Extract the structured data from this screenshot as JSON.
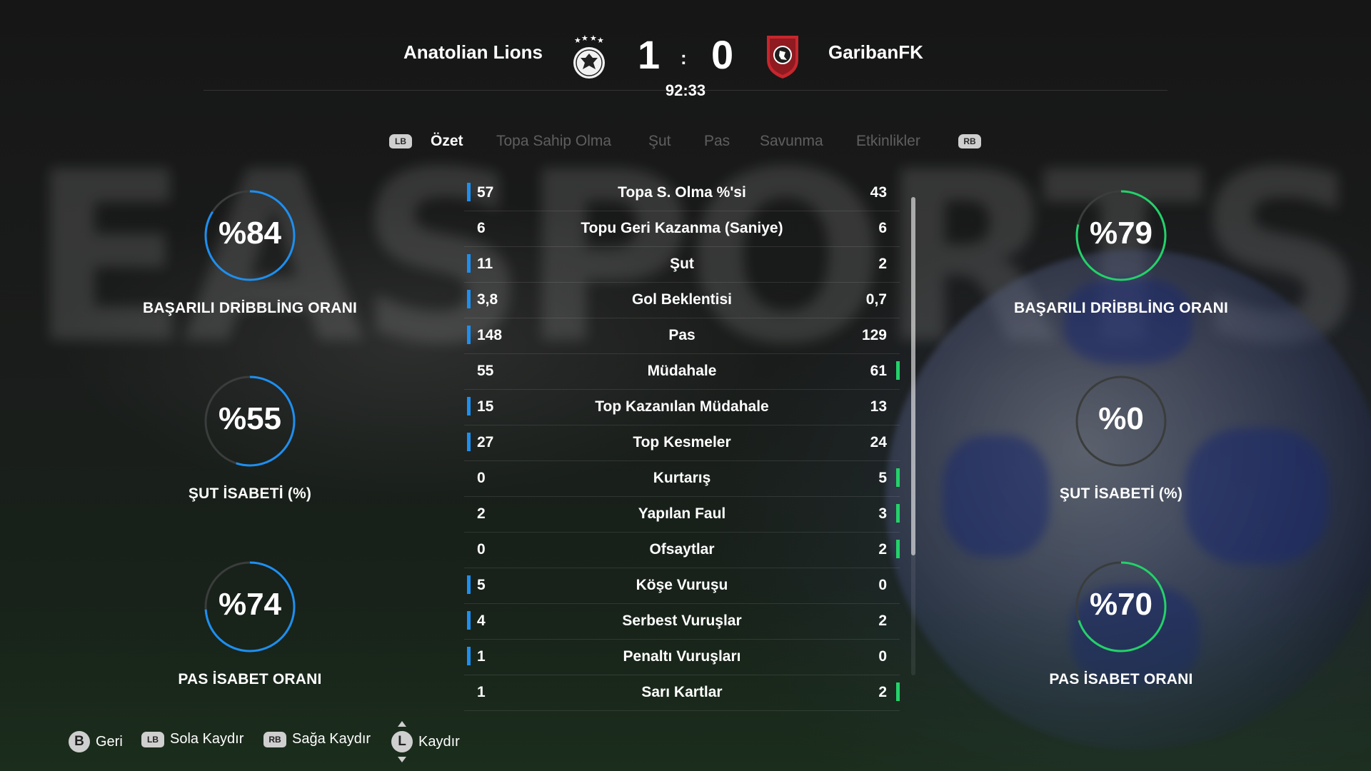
{
  "match": {
    "home_team": "Anatolian Lions",
    "away_team": "GaribanFK",
    "home_score": "1",
    "separator": ":",
    "away_score": "0",
    "clock": "92:33"
  },
  "background_text": "EASPORTSF",
  "tabs": {
    "left_bumper": "LB",
    "right_bumper": "RB",
    "items": [
      "Özet",
      "Topa Sahip Olma",
      "Şut",
      "Pas",
      "Savunma",
      "Etkinlikler"
    ],
    "active": "Özet"
  },
  "home_circles": [
    {
      "value_text": "%84",
      "value": 84,
      "label": "BAŞARILI DRİBBLİNG ORANI"
    },
    {
      "value_text": "%55",
      "value": 55,
      "label": "ŞUT İSABETİ (%)"
    },
    {
      "value_text": "%74",
      "value": 74,
      "label": "PAS İSABET ORANI"
    }
  ],
  "away_circles": [
    {
      "value_text": "%79",
      "value": 79,
      "label": "BAŞARILI DRİBBLİNG ORANI"
    },
    {
      "value_text": "%0",
      "value": 0,
      "label": "ŞUT İSABETİ (%)"
    },
    {
      "value_text": "%70",
      "value": 70,
      "label": "PAS İSABET ORANI"
    }
  ],
  "stats": [
    {
      "home": "57",
      "label": "Topa S. Olma %'si",
      "away": "43",
      "lead": "home"
    },
    {
      "home": "6",
      "label": "Topu Geri Kazanma (Saniye)",
      "away": "6",
      "lead": "none"
    },
    {
      "home": "11",
      "label": "Şut",
      "away": "2",
      "lead": "home"
    },
    {
      "home": "3,8",
      "label": "Gol Beklentisi",
      "away": "0,7",
      "lead": "home"
    },
    {
      "home": "148",
      "label": "Pas",
      "away": "129",
      "lead": "home"
    },
    {
      "home": "55",
      "label": "Müdahale",
      "away": "61",
      "lead": "away"
    },
    {
      "home": "15",
      "label": "Top Kazanılan Müdahale",
      "away": "13",
      "lead": "home"
    },
    {
      "home": "27",
      "label": "Top Kesmeler",
      "away": "24",
      "lead": "home"
    },
    {
      "home": "0",
      "label": "Kurtarış",
      "away": "5",
      "lead": "away"
    },
    {
      "home": "2",
      "label": "Yapılan Faul",
      "away": "3",
      "lead": "away"
    },
    {
      "home": "0",
      "label": "Ofsaytlar",
      "away": "2",
      "lead": "away"
    },
    {
      "home": "5",
      "label": "Köşe Vuruşu",
      "away": "0",
      "lead": "home"
    },
    {
      "home": "4",
      "label": "Serbest Vuruşlar",
      "away": "2",
      "lead": "home"
    },
    {
      "home": "1",
      "label": "Penaltı Vuruşları",
      "away": "0",
      "lead": "home"
    },
    {
      "home": "1",
      "label": "Sarı Kartlar",
      "away": "2",
      "lead": "away"
    }
  ],
  "footer": {
    "back_key": "B",
    "back_label": "Geri",
    "left_key": "LB",
    "left_label": "Sola Kaydır",
    "right_key": "RB",
    "right_label": "Sağa Kaydır",
    "scroll_key": "L",
    "scroll_label": "Kaydır"
  },
  "colors": {
    "home_accent": "#1d8ff0",
    "away_accent": "#23d26a",
    "ring_track": "#3a3d3c"
  }
}
